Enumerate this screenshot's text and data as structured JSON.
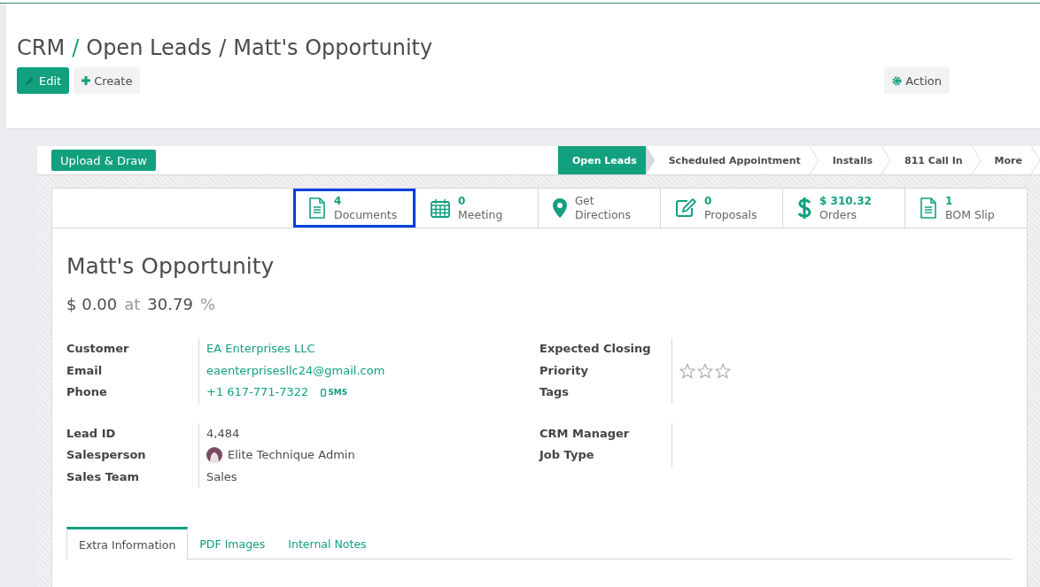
{
  "breadcrumbs": [
    "CRM",
    "Open Leads",
    "Matt's Opportunity"
  ],
  "breadcrumb_separator": "/",
  "buttons": [
    {
      "label": "Edit",
      "kind": "primary"
    },
    {
      "label": "Create",
      "kind": "secondary"
    }
  ],
  "action_button": {
    "label": "Action"
  },
  "header_button": {
    "label": "Upload & Draw"
  },
  "stages": [
    {
      "label": "Open Leads",
      "selected": true
    },
    {
      "label": "Scheduled Appointment",
      "selected": false
    },
    {
      "label": "Installs",
      "selected": false
    },
    {
      "label": "811 Call In",
      "selected": false
    },
    {
      "label": "More",
      "selected": false
    }
  ],
  "smart_buttons": [
    {
      "kind": "document",
      "value": "4",
      "label": "Documents",
      "highlighted": true
    },
    {
      "kind": "calendar",
      "value": "0",
      "label": "Meeting",
      "highlighted": false
    },
    {
      "kind": "pin",
      "value": "Get",
      "label": "Directions",
      "highlighted": false
    },
    {
      "kind": "edit",
      "value": "0",
      "label": "Proposals",
      "highlighted": false
    },
    {
      "kind": "dollar",
      "value": "$ 310.32",
      "label": "Orders",
      "highlighted": false
    },
    {
      "kind": "document",
      "value": "1",
      "label": "BOM Slip",
      "highlighted": false
    }
  ],
  "title": "Matt's Opportunity",
  "revenue": {
    "amount": "$ 0.00",
    "at": "at",
    "probability": "30.79",
    "percent": "%"
  },
  "left_groups": [
    [
      {
        "label": "Customer",
        "kind": "link",
        "value": "EA Enterprises LLC"
      },
      {
        "label": "Email",
        "kind": "link",
        "value": "eaenterprisesllc24@gmail.com"
      },
      {
        "label": "Phone",
        "kind": "phone",
        "value": "+1 617-771-7322",
        "action": "SMS"
      }
    ],
    [
      {
        "label": "Lead ID",
        "kind": "text",
        "value": "4,484"
      },
      {
        "label": "Salesperson",
        "kind": "user",
        "value": "Elite Technique Admin"
      },
      {
        "label": "Sales Team",
        "kind": "text",
        "value": "Sales"
      }
    ]
  ],
  "right_groups": [
    [
      {
        "label": "Expected Closing",
        "kind": "empty"
      },
      {
        "label": "Priority",
        "kind": "stars",
        "stars": 0
      },
      {
        "label": "Tags",
        "kind": "empty"
      }
    ],
    [
      {
        "label": "CRM Manager",
        "kind": "empty"
      },
      {
        "label": "Job Type",
        "kind": "empty"
      }
    ]
  ],
  "tabs": [
    {
      "label": "Extra Information",
      "selected": true
    },
    {
      "label": "PDF Images",
      "selected": false
    },
    {
      "label": "Internal Notes",
      "selected": false
    }
  ]
}
